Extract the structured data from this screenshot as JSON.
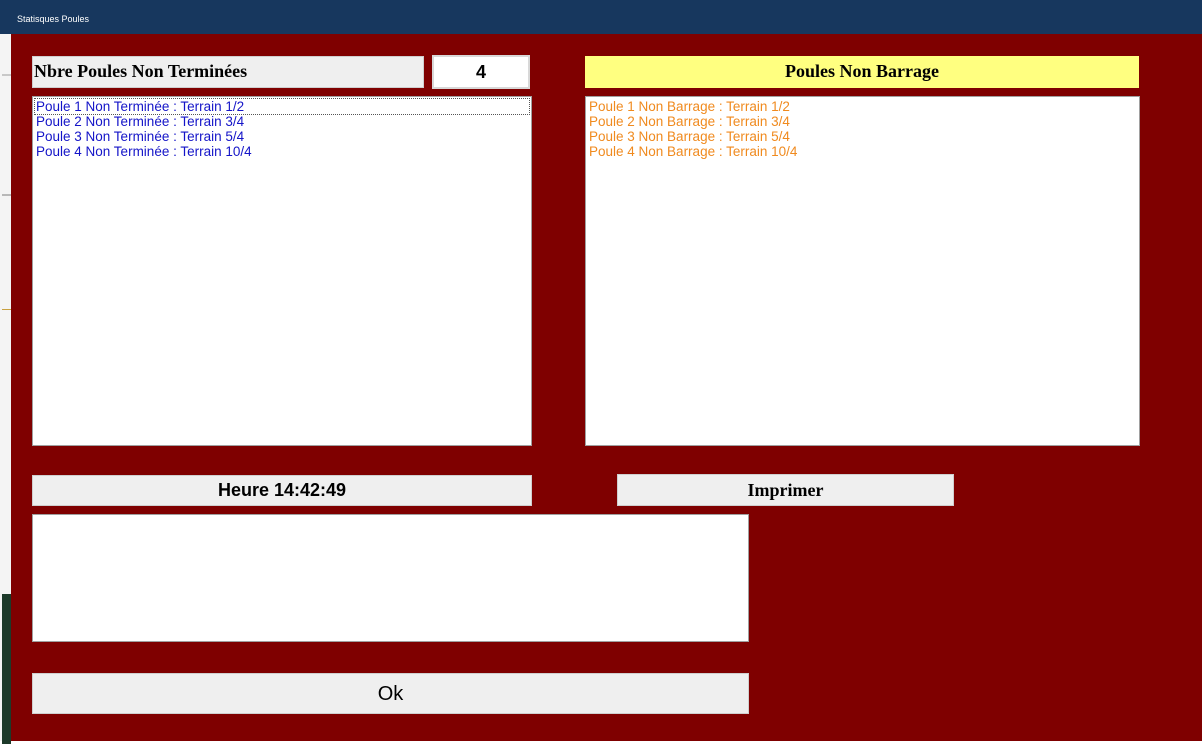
{
  "window": {
    "title": "Statisques Poules"
  },
  "colors": {
    "form_background": "#7f0000",
    "titlebar": "#17375e",
    "non_terminee_text": "#1414c8",
    "non_barrage_text": "#f08a1e",
    "barrage_header_bg": "#ffff80"
  },
  "non_terminees": {
    "label": "Nbre Poules Non Terminées",
    "count": "4",
    "items": [
      "Poule 1 Non Terminée : Terrain 1/2",
      "Poule 2 Non Terminée : Terrain 3/4",
      "Poule 3 Non Terminée : Terrain 5/4",
      "Poule 4 Non Terminée : Terrain 10/4"
    ]
  },
  "non_barrage": {
    "header": "Poules Non Barrage",
    "items": [
      "Poule 1 Non Barrage : Terrain 1/2",
      "Poule 2 Non Barrage : Terrain 3/4",
      "Poule 3 Non Barrage : Terrain 5/4",
      "Poule 4 Non Barrage : Terrain 10/4"
    ]
  },
  "heure": "Heure 14:42:49",
  "buttons": {
    "imprimer": "Imprimer",
    "ok": "Ok"
  },
  "memo": {
    "value": ""
  }
}
